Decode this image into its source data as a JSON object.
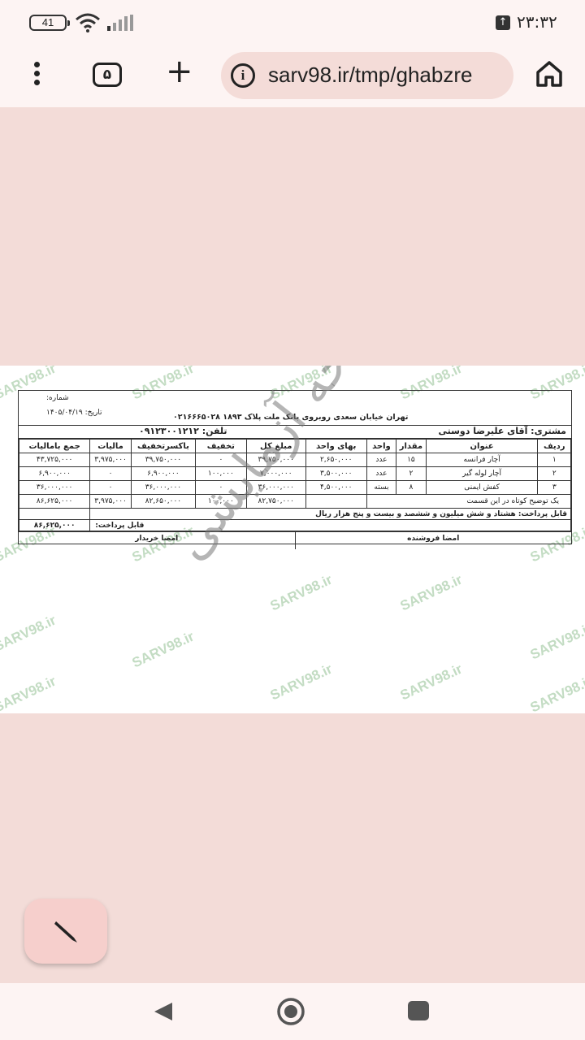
{
  "status": {
    "battery": "41",
    "time": "۲۳:۳۲"
  },
  "browser": {
    "tab_count": "۵",
    "url": "sarv98.ir/tmp/ghabzre",
    "new_tab": "+"
  },
  "watermark": {
    "text": "SARV98.ir",
    "stamp": "نسخه آزمایشی"
  },
  "invoice": {
    "number_label": "شماره:",
    "date_label": "تاریخ: ۱۴۰۵/۰۴/۱۹",
    "address": "تهران خیابان سعدی روبروی بانک ملت پلاک ۱۸۹۳ ۰۲۱۶۶۶۵۰۲۸",
    "customer": "مشتری: آقای علیرضا دوستی",
    "phone": "تلفن: ۰۹۱۲۳۰۰۱۲۱۲",
    "headers": [
      "ردیف",
      "عنوان",
      "مقدار",
      "واحد",
      "بهای واحد",
      "مبلغ کل",
      "تخفیف",
      "باکسرتخفیف",
      "مالیات",
      "جمع بامالیات"
    ],
    "rows": [
      {
        "idx": "۱",
        "title": "آچار فرانسه",
        "qty": "۱۵",
        "unit": "عدد",
        "price": "۲,۶۵۰,۰۰۰",
        "total": "۳۹,۷۵۰,۰۰۰",
        "discount": "۰",
        "after": "۳۹,۷۵۰,۰۰۰",
        "tax": "۳,۹۷۵,۰۰۰",
        "grand": "۴۳,۷۲۵,۰۰۰"
      },
      {
        "idx": "۲",
        "title": "آچار لوله گیر",
        "qty": "۲",
        "unit": "عدد",
        "price": "۳,۵۰۰,۰۰۰",
        "total": "۷,۰۰۰,۰۰۰",
        "discount": "۱۰۰,۰۰۰",
        "after": "۶,۹۰۰,۰۰۰",
        "tax": "۰",
        "grand": "۶,۹۰۰,۰۰۰"
      },
      {
        "idx": "۳",
        "title": "کفش ایمنی",
        "qty": "۸",
        "unit": "بسته",
        "price": "۴,۵۰۰,۰۰۰",
        "total": "۳۶,۰۰۰,۰۰۰",
        "discount": "۰",
        "after": "۳۶,۰۰۰,۰۰۰",
        "tax": "۰",
        "grand": "۳۶,۰۰۰,۰۰۰"
      }
    ],
    "totals": {
      "desc": "یک توضیح کوتاه در این قسمت",
      "total": "۸۲,۷۵۰,۰۰۰",
      "discount": "۱۰۰,۰۰۰",
      "after": "۸۲,۶۵۰,۰۰۰",
      "tax": "۳,۹۷۵,۰۰۰",
      "grand": "۸۶,۶۲۵,۰۰۰"
    },
    "pay_words": "قابل پرداخت: هشتاد و شش میلیون و ششصد و بیست و پنج هزار ریال",
    "payable_label": "قابل پرداخت:",
    "payable_value": "۸۶,۶۲۵,۰۰۰",
    "seller_sign": "امضا فروشنده",
    "buyer_sign": "امضا خریدار"
  },
  "colors": {
    "background": "#f3dcd8",
    "bar": "#fdf4f3",
    "fab": "#f6cfcc",
    "watermark": "#b9d7b9"
  }
}
